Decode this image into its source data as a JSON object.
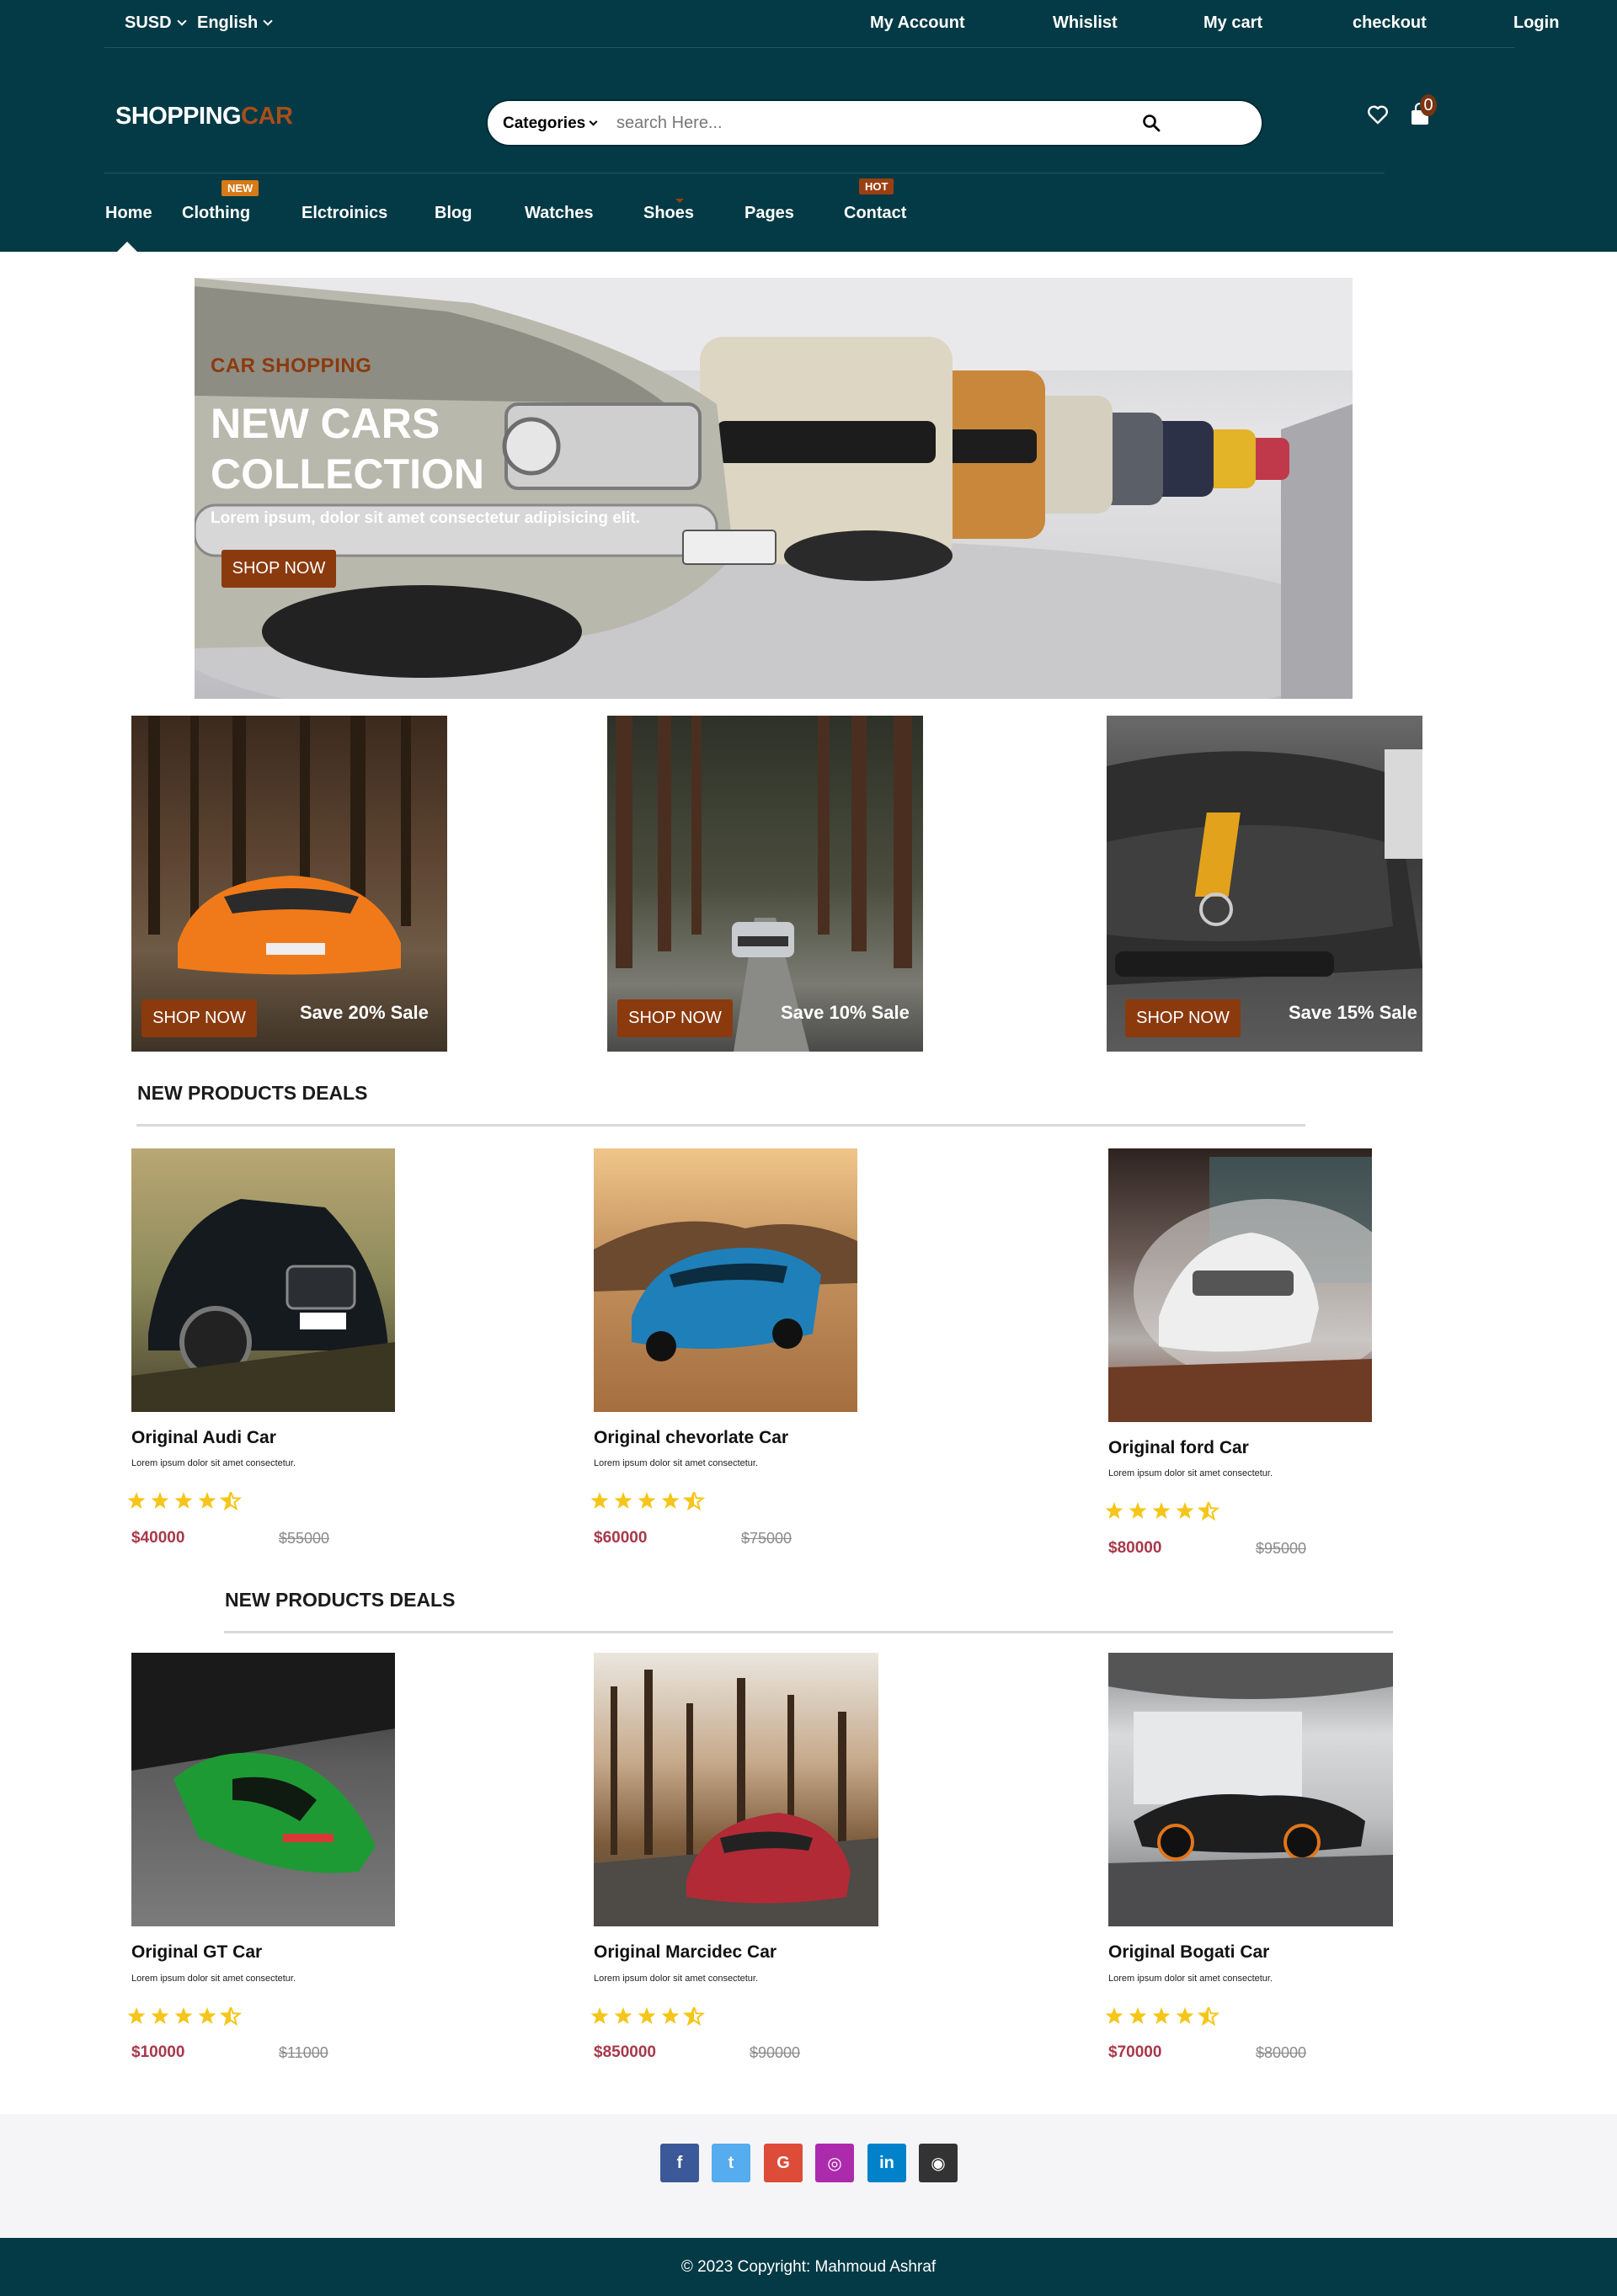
{
  "topbar": {
    "currency": "SUSD",
    "language": "English",
    "links": [
      "My Account",
      "Whislist",
      "My cart",
      "checkout",
      "Login"
    ]
  },
  "header": {
    "logo_part1": "SHOPPING",
    "logo_part2": "CAR",
    "search": {
      "category_label": "Categories",
      "placeholder": "search Here..."
    },
    "cart_count": "0"
  },
  "nav": {
    "items": [
      "Home",
      "Clothing",
      "Elctroinics",
      "Blog",
      "Watches",
      "Shoes",
      "Pages",
      "Contact"
    ],
    "badge_new": "NEW",
    "badge_hot": "HOT"
  },
  "hero": {
    "eyebrow": "CAR SHOPPING",
    "title_line1": "NEW CARS",
    "title_line2": "COLLECTION",
    "text": "Lorem ipsum, dolor sit amet consectetur adipisicing elit.",
    "button": "SHOP NOW"
  },
  "promos": [
    {
      "button": "SHOP NOW",
      "sale": "Save 20% Sale"
    },
    {
      "button": "SHOP NOW",
      "sale": "Save 10% Sale"
    },
    {
      "button": "SHOP NOW",
      "sale": "Save 15% Sale"
    }
  ],
  "section1": {
    "title": "NEW PRODUCTS DEALS",
    "products": [
      {
        "name": "Original Audi Car",
        "desc": "Lorem ipsum dolor sit amet consectetur.",
        "price": "$40000",
        "old_price": "$55000",
        "rating": 4.5
      },
      {
        "name": "Original chevorlate Car",
        "desc": "Lorem ipsum dolor sit amet consectetur.",
        "price": "$60000",
        "old_price": "$75000",
        "rating": 4.5
      },
      {
        "name": "Original ford Car",
        "desc": "Lorem ipsum dolor sit amet consectetur.",
        "price": "$80000",
        "old_price": "$95000",
        "rating": 4.5
      }
    ]
  },
  "section2": {
    "title": "NEW PRODUCTS DEALS",
    "products": [
      {
        "name": "Original GT Car",
        "desc": "Lorem ipsum dolor sit amet consectetur.",
        "price": "$10000",
        "old_price": "$11000",
        "rating": 4.5
      },
      {
        "name": "Original Marcidec Car",
        "desc": "Lorem ipsum dolor sit amet consectetur.",
        "price": "$850000",
        "old_price": "$90000",
        "rating": 4.5
      },
      {
        "name": "Original Bogati Car",
        "desc": "Lorem ipsum dolor sit amet consectetur.",
        "price": "$70000",
        "old_price": "$80000",
        "rating": 4.5
      }
    ]
  },
  "social": {
    "icons": [
      "facebook-icon",
      "twitter-icon",
      "google-icon",
      "instagram-icon",
      "linkedin-icon",
      "github-icon"
    ],
    "colors": [
      "#3b5998",
      "#55acee",
      "#dd4b39",
      "#ac2bac",
      "#0082ca",
      "#333333"
    ]
  },
  "footer": {
    "copyright": "© 2023 Copyright: Mahmoud Ashraf"
  },
  "colors": {
    "header_bg": "#033a45",
    "accent": "#8b3a0e",
    "price": "#a8384a",
    "star": "#f5c518",
    "badge_new": "#d77a17",
    "badge_hot": "#9b3f12"
  }
}
